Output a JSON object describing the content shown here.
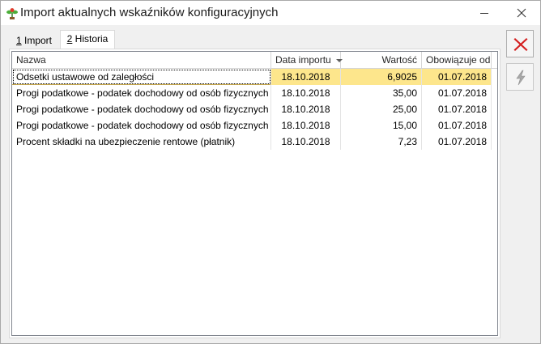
{
  "window": {
    "title": "Import aktualnych wskaźników konfiguracyjnych"
  },
  "tabs": [
    {
      "hotkey": "1",
      "label": " Import"
    },
    {
      "hotkey": "2",
      "label": " Historia"
    }
  ],
  "grid": {
    "columns": [
      "Nazwa",
      "Data importu",
      "Wartość",
      "Obowiązuje od"
    ],
    "sorted_column": "Data importu",
    "rows": [
      {
        "name": "Odsetki ustawowe od zaległości",
        "date": "18.10.2018",
        "value": "6,9025",
        "from": "01.07.2018",
        "selected": true
      },
      {
        "name": "Progi podatkowe - podatek dochodowy od osób fizycznych \\ P...",
        "date": "18.10.2018",
        "value": "35,00",
        "from": "01.07.2018"
      },
      {
        "name": "Progi podatkowe - podatek dochodowy od osób fizycznych \\ P...",
        "date": "18.10.2018",
        "value": "25,00",
        "from": "01.07.2018"
      },
      {
        "name": "Progi podatkowe - podatek dochodowy od osób fizycznych \\ P...",
        "date": "18.10.2018",
        "value": "15,00",
        "from": "01.07.2018"
      },
      {
        "name": "Procent składki na ubezpieczenie rentowe (płatnik)",
        "date": "18.10.2018",
        "value": "7,23",
        "from": "01.07.2018"
      }
    ]
  },
  "icons": {
    "app": "plant-icon",
    "minimize": "minimize-icon",
    "close": "close-icon",
    "cancel": "red-x-icon",
    "run": "lightning-icon"
  },
  "colors": {
    "selection": "#fde68c",
    "cancel_red": "#d42020",
    "run_disabled": "#a8a8a8"
  }
}
